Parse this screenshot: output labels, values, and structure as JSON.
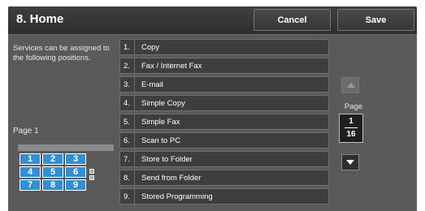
{
  "header": {
    "title": "8. Home",
    "cancel_label": "Cancel",
    "save_label": "Save"
  },
  "description": "Services can be assigned to the following positions.",
  "page_indicator_label": "Page 1",
  "keypad": {
    "keys": [
      "1",
      "2",
      "3",
      "4",
      "5",
      "6",
      "7",
      "8",
      "9"
    ]
  },
  "services": [
    {
      "num": "1.",
      "label": "Copy"
    },
    {
      "num": "2.",
      "label": "Fax / Internet Fax"
    },
    {
      "num": "3.",
      "label": "E-mail"
    },
    {
      "num": "4.",
      "label": "Simple Copy"
    },
    {
      "num": "5.",
      "label": "Simple Fax"
    },
    {
      "num": "6.",
      "label": "Scan to PC"
    },
    {
      "num": "7.",
      "label": "Store to Folder"
    },
    {
      "num": "8.",
      "label": "Send from Folder"
    },
    {
      "num": "9.",
      "label": "Stored Programming"
    }
  ],
  "pager": {
    "caption": "Page",
    "current": "1",
    "total": "16"
  },
  "colors": {
    "accent_key": "#2f8fd8",
    "panel_bg": "#5a5a5a",
    "row_bg": "#3e3e3e"
  }
}
